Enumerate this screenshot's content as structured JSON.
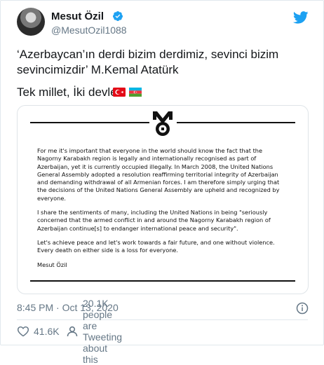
{
  "author": {
    "name": "Mesut Özil",
    "handle": "@MesutOzil1088"
  },
  "tweet": {
    "line1": "‘Azerbaycan’ın derdi bizim derdimiz, sevinci bizim",
    "line1b": "sevincimizdir’ M.Kemal Atatürk",
    "line2": "Tek millet, İki devlet"
  },
  "statement": {
    "paragraphs": [
      "For me it's important that everyone in the world should know the fact that the Nagorny Karabakh region is legally and internationally recognised as part of Azerbaijan, yet it is currently occupied illegally. In March 2008, the United Nations General Assembly adopted a resolution reaffirming territorial integrity of Azerbaijan and demanding withdrawal of all Armenian forces. I am therefore simply urging that the decisions of the United Nations General Assembly are upheld and recognized by everyone.",
      "I share the sentiments of many, including the United Nations in being \"seriously concerned that the armed conflict in and around the Nagorny Karabakh region of Azerbaijan continue[s] to endanger international peace and security\".",
      "Let's achieve peace and let's work towards a fair future, and one without violence. Every death on either side is a loss for everyone."
    ],
    "signature": "Mesut Özil"
  },
  "meta": {
    "timestamp": "8:45 PM · Oct 13, 2020"
  },
  "stats": {
    "likes": "41.6K",
    "retweet_text": "20.1K people are Tweeting about this"
  },
  "colors": {
    "twitter_blue": "#1da1f2",
    "turkey_red": "#e30a17",
    "az_blue": "#00b5e2",
    "az_red": "#ef3340",
    "az_green": "#509e2f"
  },
  "icons": [
    "verified-icon",
    "twitter-bird-icon",
    "mo-logo-icon",
    "info-icon",
    "heart-icon",
    "people-icon"
  ]
}
